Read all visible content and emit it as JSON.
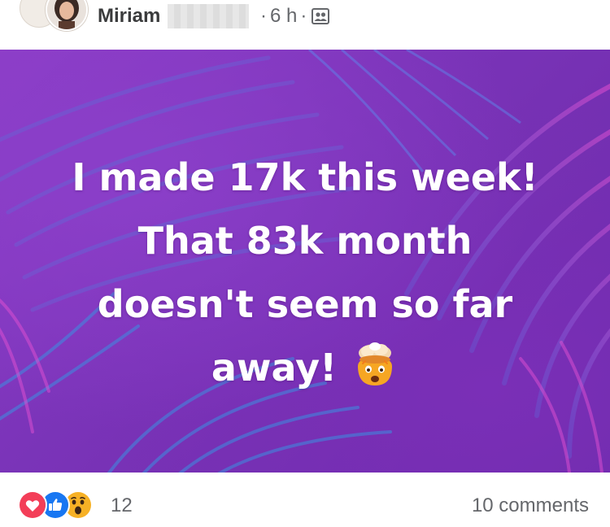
{
  "header": {
    "author_name": "Miriam",
    "time_ago": "6 h",
    "separator": "·",
    "audience_icon": "friends-icon"
  },
  "post": {
    "background_color": "#7b34b9",
    "text_color": "#ffffff",
    "lines": [
      "I made 17k this week!",
      "That 83k month",
      "doesn't seem so far",
      "away!"
    ],
    "emoji": "exploding-head-emoji"
  },
  "footer": {
    "reactions": [
      "love-reaction-icon",
      "like-reaction-icon",
      "wow-reaction-icon"
    ],
    "reaction_count": "12",
    "comments": "10 comments"
  },
  "colors": {
    "love": "#f33e58",
    "like": "#1877f2",
    "wow": "#f7b125",
    "meta_text": "#65676b"
  }
}
